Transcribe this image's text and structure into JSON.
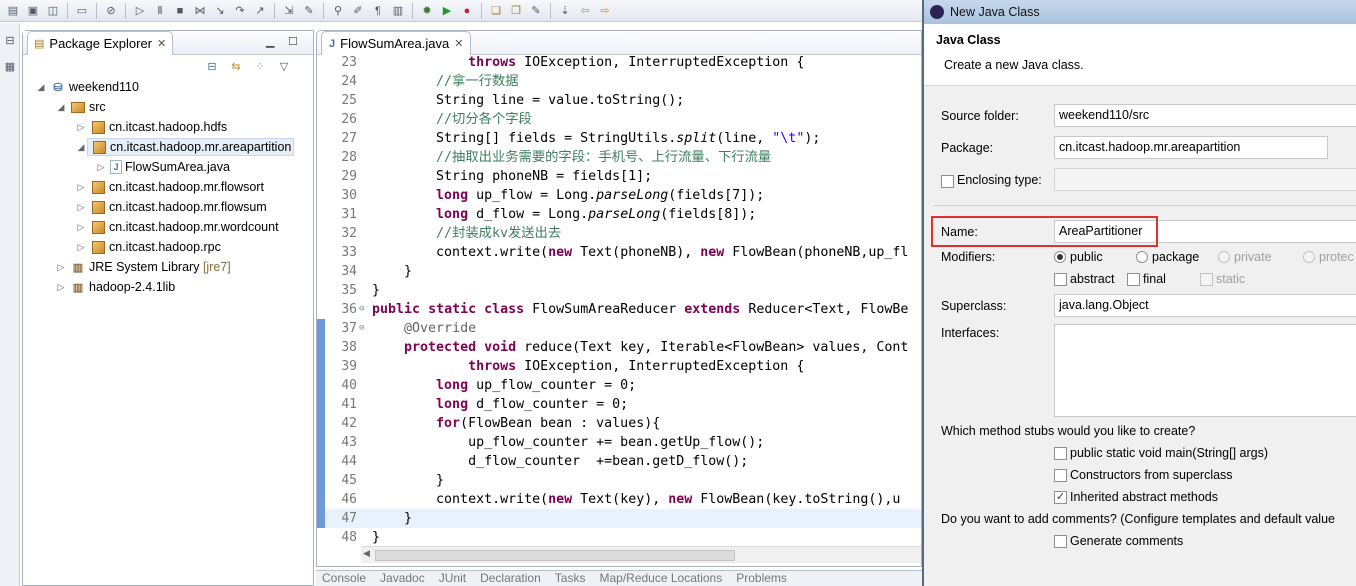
{
  "toolbar": {
    "icons": [
      "new-icon",
      "save-icon",
      "save-all-icon",
      "print-icon",
      "debug-skip-icon",
      "resume-icon",
      "suspend-icon",
      "stop-icon",
      "disconnect-icon",
      "step-into-icon",
      "step-over-icon",
      "step-return-icon",
      "drop-frame-icon",
      "toggle-mark-icon",
      "search-icon",
      "pin-icon",
      "show-whitespace-icon",
      "debug-icon",
      "run-icon",
      "external-tools-icon",
      "new-java-project-icon",
      "open-type-icon",
      "open-task-icon",
      "annotation-icon",
      "back-icon",
      "forward-icon",
      "nav-icon"
    ]
  },
  "package_explorer": {
    "title": "Package Explorer",
    "items": [
      {
        "label": "weekend110",
        "suffix": ""
      },
      {
        "label": "src",
        "suffix": ""
      },
      {
        "label": "cn.itcast.hadoop.hdfs",
        "suffix": ""
      },
      {
        "label": "cn.itcast.hadoop.mr.areapartition",
        "suffix": ""
      },
      {
        "label": "FlowSumArea.java",
        "suffix": ""
      },
      {
        "label": "cn.itcast.hadoop.mr.flowsort",
        "suffix": ""
      },
      {
        "label": "cn.itcast.hadoop.mr.flowsum",
        "suffix": ""
      },
      {
        "label": "cn.itcast.hadoop.mr.wordcount",
        "suffix": ""
      },
      {
        "label": "cn.itcast.hadoop.rpc",
        "suffix": ""
      },
      {
        "label": "JRE System Library",
        "suffix": "[jre7]"
      },
      {
        "label": "hadoop-2.4.1lib",
        "suffix": ""
      }
    ]
  },
  "editor": {
    "tab": "FlowSumArea.java",
    "lines": [
      {
        "n": "23",
        "fold": "",
        "hl": false,
        "chg": false,
        "tok": [
          [
            "",
            "            "
          ],
          [
            "kw",
            "throws"
          ],
          [
            "",
            " IOException, InterruptedException {"
          ]
        ]
      },
      {
        "n": "24",
        "fold": "",
        "hl": false,
        "chg": false,
        "tok": [
          [
            "",
            "        "
          ],
          [
            "cm",
            "//拿一行数据"
          ]
        ]
      },
      {
        "n": "25",
        "fold": "",
        "hl": false,
        "chg": false,
        "tok": [
          [
            "",
            "        String line = value.toString();"
          ]
        ]
      },
      {
        "n": "26",
        "fold": "",
        "hl": false,
        "chg": false,
        "tok": [
          [
            "",
            "        "
          ],
          [
            "cm",
            "//切分各个字段"
          ]
        ]
      },
      {
        "n": "27",
        "fold": "",
        "hl": false,
        "chg": false,
        "tok": [
          [
            "",
            "        String[] fields = StringUtils."
          ],
          [
            "it",
            "split"
          ],
          [
            "",
            "(line, "
          ],
          [
            "st",
            "\"\\t\""
          ],
          [
            "",
            ");"
          ]
        ]
      },
      {
        "n": "28",
        "fold": "",
        "hl": false,
        "chg": false,
        "tok": [
          [
            "",
            "        "
          ],
          [
            "cm",
            "//抽取出业务需要的字段：手机号、上行流量、下行流量"
          ]
        ]
      },
      {
        "n": "29",
        "fold": "",
        "hl": false,
        "chg": false,
        "tok": [
          [
            "",
            "        String phoneNB = fields[1];"
          ]
        ]
      },
      {
        "n": "30",
        "fold": "",
        "hl": false,
        "chg": false,
        "tok": [
          [
            "",
            "        "
          ],
          [
            "kw",
            "long"
          ],
          [
            "",
            " up_flow = Long."
          ],
          [
            "it",
            "parseLong"
          ],
          [
            "",
            "(fields[7]);"
          ]
        ]
      },
      {
        "n": "31",
        "fold": "",
        "hl": false,
        "chg": false,
        "tok": [
          [
            "",
            "        "
          ],
          [
            "kw",
            "long"
          ],
          [
            "",
            " d_flow = Long."
          ],
          [
            "it",
            "parseLong"
          ],
          [
            "",
            "(fields[8]);"
          ]
        ]
      },
      {
        "n": "32",
        "fold": "",
        "hl": false,
        "chg": false,
        "tok": [
          [
            "",
            "        "
          ],
          [
            "cm",
            "//封装成kv发送出去"
          ]
        ]
      },
      {
        "n": "33",
        "fold": "",
        "hl": false,
        "chg": false,
        "tok": [
          [
            "",
            "        context.write("
          ],
          [
            "kw",
            "new"
          ],
          [
            "",
            " Text(phoneNB), "
          ],
          [
            "kw",
            "new"
          ],
          [
            "",
            " FlowBean(phoneNB,up_fl"
          ]
        ]
      },
      {
        "n": "34",
        "fold": "",
        "hl": false,
        "chg": false,
        "tok": [
          [
            "",
            "    }"
          ]
        ]
      },
      {
        "n": "35",
        "fold": "",
        "hl": false,
        "chg": false,
        "tok": [
          [
            "",
            "}"
          ]
        ]
      },
      {
        "n": "36",
        "fold": "⊖",
        "hl": false,
        "chg": false,
        "tok": [
          [
            "kw",
            "public"
          ],
          [
            "",
            " "
          ],
          [
            "kw",
            "static"
          ],
          [
            "",
            " "
          ],
          [
            "kw",
            "class"
          ],
          [
            "",
            " FlowSumAreaReducer "
          ],
          [
            "kw",
            "extends"
          ],
          [
            "",
            " Reducer<Text, FlowBe"
          ]
        ]
      },
      {
        "n": "37",
        "fold": "⊖",
        "hl": false,
        "chg": true,
        "tok": [
          [
            "",
            "    "
          ],
          [
            "an",
            "@Override"
          ]
        ]
      },
      {
        "n": "38",
        "fold": "",
        "hl": false,
        "chg": true,
        "tok": [
          [
            "",
            "    "
          ],
          [
            "kw",
            "protected"
          ],
          [
            "",
            " "
          ],
          [
            "kw",
            "void"
          ],
          [
            "",
            " reduce(Text key, Iterable<FlowBean> values, Cont"
          ]
        ]
      },
      {
        "n": "39",
        "fold": "",
        "hl": false,
        "chg": true,
        "tok": [
          [
            "",
            "            "
          ],
          [
            "kw",
            "throws"
          ],
          [
            "",
            " IOException, InterruptedException {"
          ]
        ]
      },
      {
        "n": "40",
        "fold": "",
        "hl": false,
        "chg": true,
        "tok": [
          [
            "",
            "        "
          ],
          [
            "kw",
            "long"
          ],
          [
            "",
            " up_flow_counter = 0;"
          ]
        ]
      },
      {
        "n": "41",
        "fold": "",
        "hl": false,
        "chg": true,
        "tok": [
          [
            "",
            "        "
          ],
          [
            "kw",
            "long"
          ],
          [
            "",
            " d_flow_counter = 0;"
          ]
        ]
      },
      {
        "n": "42",
        "fold": "",
        "hl": false,
        "chg": true,
        "tok": [
          [
            "",
            "        "
          ],
          [
            "kw",
            "for"
          ],
          [
            "",
            "(FlowBean bean : values){"
          ]
        ]
      },
      {
        "n": "43",
        "fold": "",
        "hl": false,
        "chg": true,
        "tok": [
          [
            "",
            "            up_flow_counter += bean.getUp_flow();"
          ]
        ]
      },
      {
        "n": "44",
        "fold": "",
        "hl": false,
        "chg": true,
        "tok": [
          [
            "",
            "            d_flow_counter  +=bean.getD_flow();"
          ]
        ]
      },
      {
        "n": "45",
        "fold": "",
        "hl": false,
        "chg": true,
        "tok": [
          [
            "",
            "        }"
          ]
        ]
      },
      {
        "n": "46",
        "fold": "",
        "hl": false,
        "chg": true,
        "tok": [
          [
            "",
            "        context.write("
          ],
          [
            "kw",
            "new"
          ],
          [
            "",
            " Text(key), "
          ],
          [
            "kw",
            "new"
          ],
          [
            "",
            " FlowBean(key.toString(),u"
          ]
        ]
      },
      {
        "n": "47",
        "fold": "",
        "hl": true,
        "chg": true,
        "tok": [
          [
            "",
            "    }"
          ]
        ]
      },
      {
        "n": "48",
        "fold": "",
        "hl": false,
        "chg": false,
        "tok": [
          [
            "",
            "}"
          ]
        ]
      }
    ]
  },
  "bottom_tabs": [
    "Console",
    "Javadoc",
    "JUnit",
    "Declaration",
    "Tasks",
    "Map/Reduce Locations",
    "Problems"
  ],
  "dialog": {
    "window_title": "New Java Class",
    "heading": "Java Class",
    "description": "Create a new Java class.",
    "source_folder_label": "Source folder:",
    "source_folder_value": "weekend110/src",
    "package_label": "Package:",
    "package_value": "cn.itcast.hadoop.mr.areapartition",
    "enclosing_type_label": "Enclosing type:",
    "enclosing_type_value": "",
    "name_label": "Name:",
    "name_value": "AreaPartitioner",
    "modifiers_label": "Modifiers:",
    "mod_public": "public",
    "mod_package": "package",
    "mod_private": "private",
    "mod_protected": "protec",
    "mod_abstract": "abstract",
    "mod_final": "final",
    "mod_static": "static",
    "superclass_label": "Superclass:",
    "superclass_value": "java.lang.Object",
    "interfaces_label": "Interfaces:",
    "stubs_question": "Which method stubs would you like to create?",
    "stub_main": "public static void main(String[] args)",
    "stub_constructors": "Constructors from superclass",
    "stub_inherited": "Inherited abstract methods",
    "comments_question": "Do you want to add comments? (Configure templates and default value",
    "generate_comments": "Generate comments"
  },
  "colors": {
    "highlight_red": "#e0312f",
    "keyword": "#7f0055",
    "comment": "#3f7f5f",
    "string": "#2a00ff"
  }
}
